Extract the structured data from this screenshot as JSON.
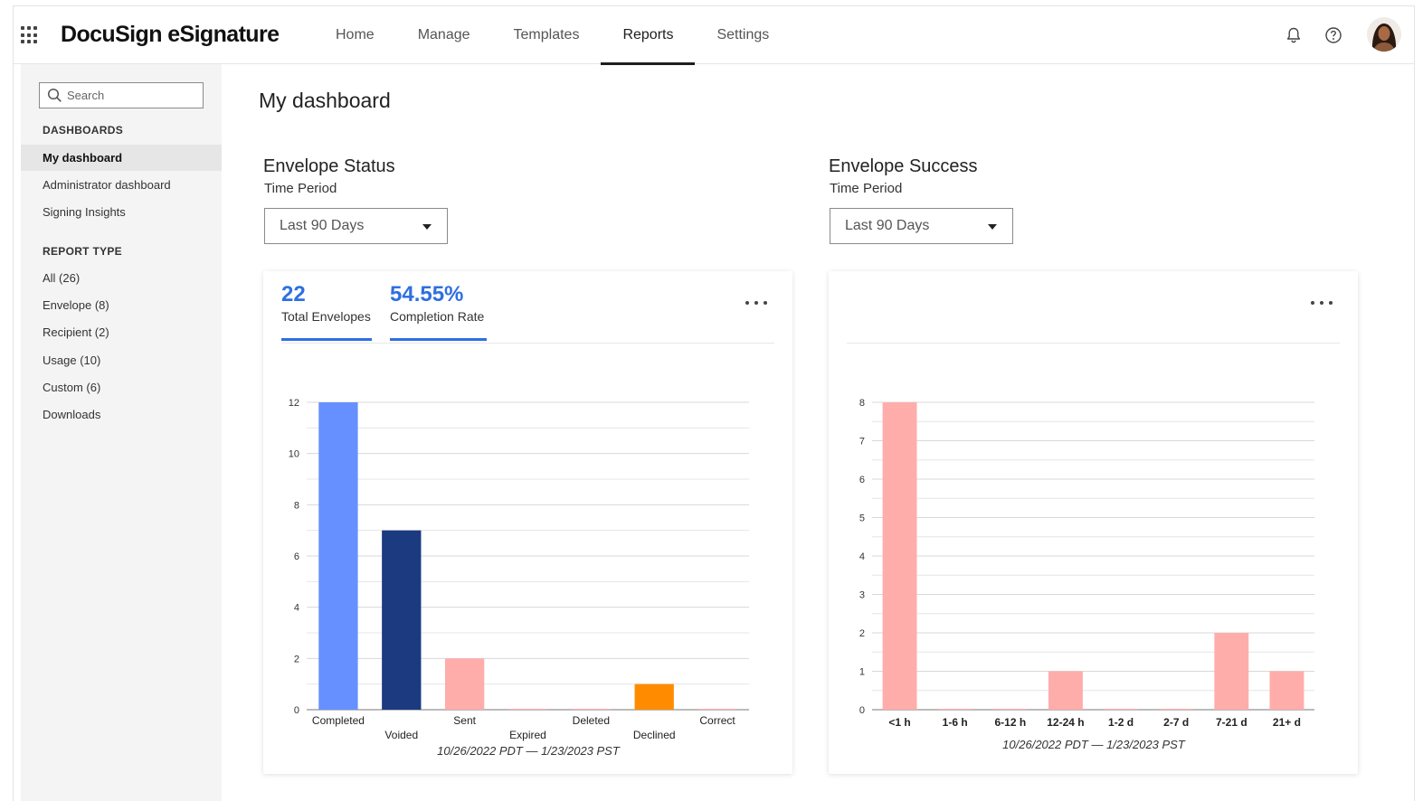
{
  "app": {
    "title": "DocuSign eSignature"
  },
  "nav": {
    "items": [
      {
        "label": "Home"
      },
      {
        "label": "Manage"
      },
      {
        "label": "Templates"
      },
      {
        "label": "Reports",
        "active": true
      },
      {
        "label": "Settings"
      }
    ]
  },
  "icons": {
    "menu": "waffle-icon",
    "notifications": "bell-icon",
    "help": "help-icon",
    "search": "search-icon",
    "more": "more-icon"
  },
  "sidebar": {
    "search_placeholder": "Search",
    "dashboards_heading": "DASHBOARDS",
    "dashboards": [
      {
        "label": "My dashboard",
        "active": true
      },
      {
        "label": "Administrator dashboard"
      },
      {
        "label": "Signing Insights"
      }
    ],
    "report_type_heading": "REPORT TYPE",
    "report_types": [
      {
        "label": "All (26)"
      },
      {
        "label": "Envelope (8)"
      },
      {
        "label": "Recipient (2)"
      },
      {
        "label": "Usage (10)"
      },
      {
        "label": "Custom (6)"
      },
      {
        "label": "Downloads"
      }
    ]
  },
  "main": {
    "title": "My dashboard",
    "envelope_status": {
      "title": "Envelope Status",
      "period_label": "Time Period",
      "period_value": "Last 90 Days",
      "kpis": [
        {
          "value": "22",
          "label": "Total Envelopes"
        },
        {
          "value": "54.55%",
          "label": "Completion Rate"
        }
      ],
      "date_range": "10/26/2022 PDT — 1/23/2023 PST"
    },
    "envelope_success": {
      "title": "Envelope Success",
      "period_label": "Time Period",
      "period_value": "Last 90 Days",
      "date_range": "10/26/2022 PDT — 1/23/2023 PST"
    }
  },
  "colors": {
    "accent": "#2f6fe0",
    "completed": "#6690ff",
    "voided": "#1b3a80",
    "sent": "#ffadaa",
    "declined": "#ff8c00",
    "success": "#ffadaa"
  },
  "chart_data": [
    {
      "type": "bar",
      "categories": [
        "Completed",
        "Voided",
        "Sent",
        "Expired",
        "Deleted",
        "Declined",
        "Correct"
      ],
      "values": [
        12,
        7,
        2,
        0,
        0,
        1,
        0
      ],
      "colors": [
        "#6690ff",
        "#1b3a80",
        "#ffadaa",
        "#ffadaa",
        "#ffadaa",
        "#ff8c00",
        "#ffadaa"
      ],
      "ylim": [
        0,
        12
      ],
      "yticks": [
        0,
        2,
        4,
        6,
        8,
        10,
        12
      ],
      "grid": true
    },
    {
      "type": "bar",
      "categories": [
        "<1 h",
        "1-6 h",
        "6-12 h",
        "12-24 h",
        "1-2 d",
        "2-7 d",
        "7-21 d",
        "21+ d"
      ],
      "values": [
        8,
        0,
        0,
        1,
        0,
        0,
        2,
        1
      ],
      "ylim": [
        0,
        8
      ],
      "yticks": [
        0,
        1,
        2,
        3,
        4,
        5,
        6,
        7,
        8
      ],
      "grid": true
    }
  ]
}
